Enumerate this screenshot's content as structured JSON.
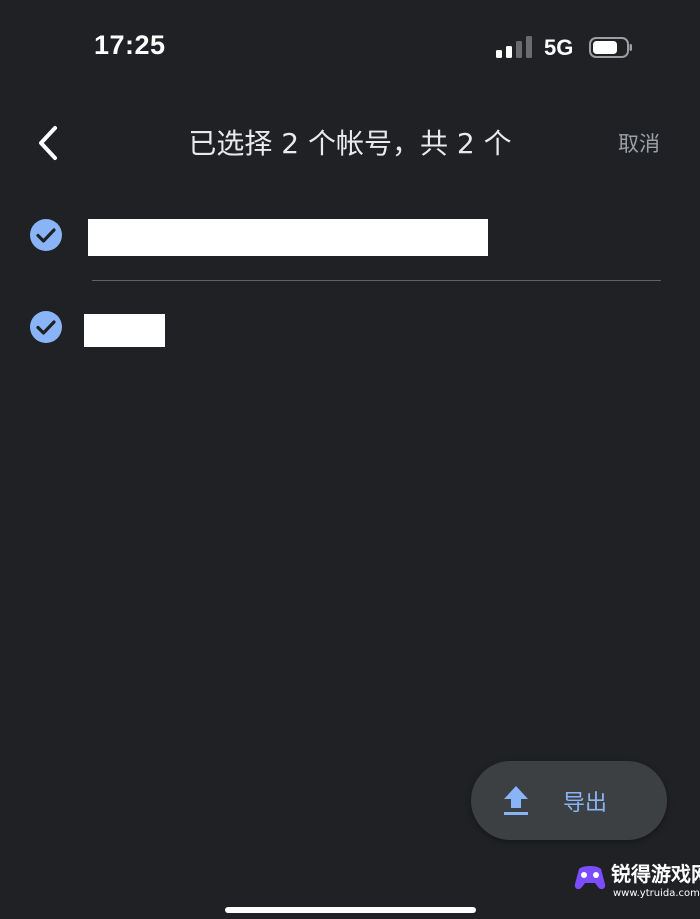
{
  "status_bar": {
    "time": "17:25",
    "network": "5G",
    "signal_bars_filled": 2,
    "signal_bars_total": 4,
    "battery_level": 0.7
  },
  "header": {
    "title": "已选择 2 个帐号，共 2 个",
    "cancel_label": "取消",
    "back_icon": "chevron-left-icon"
  },
  "accounts": [
    {
      "selected": true,
      "name_redacted": true
    },
    {
      "selected": true,
      "name_redacted": true
    }
  ],
  "export_button": {
    "label": "导出",
    "icon": "upload-icon"
  },
  "watermark": {
    "text": "锐得游戏网",
    "url": "www.ytruida.com"
  },
  "colors": {
    "background": "#202124",
    "accent": "#8ab4f8",
    "fab": "#3c4043",
    "divider": "#5f6368",
    "muted_text": "#9aa0a6"
  }
}
